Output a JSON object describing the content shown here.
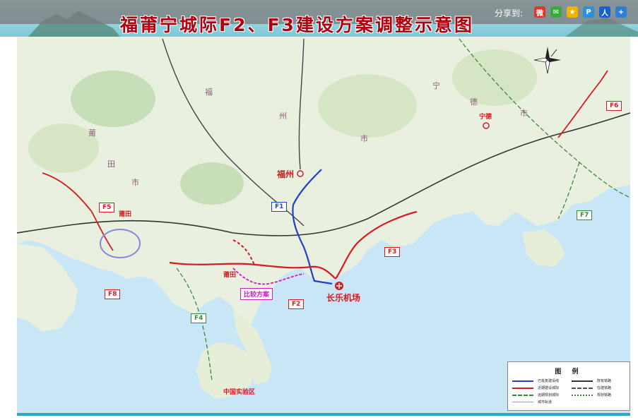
{
  "title": "福莆宁城际F2、F3建设方案调整示意图",
  "share": {
    "label": "分享到:",
    "buttons": [
      {
        "name": "weibo-share-icon",
        "glyph": "微",
        "color": "#e0382c"
      },
      {
        "name": "wechat-share-icon",
        "glyph": "✉",
        "color": "#3aa83a"
      },
      {
        "name": "qzone-share-icon",
        "glyph": "★",
        "color": "#f0b400"
      },
      {
        "name": "tencent-share-icon",
        "glyph": "P",
        "color": "#2b8fd9"
      },
      {
        "name": "renren-share-icon",
        "glyph": "人",
        "color": "#1a60c8"
      },
      {
        "name": "more-share-icon",
        "glyph": "+",
        "color": "#2d7fd5"
      }
    ]
  },
  "map": {
    "colors": {
      "f1": "#1f3fc7",
      "f2": "#d71920",
      "f3": "#d71920",
      "alt": "#cc1fb8",
      "sea": "#c8e6f6",
      "land": "#e9f0df"
    },
    "route_labels": {
      "f1": "F1",
      "f2": "F2",
      "f3": "F3",
      "f4": "F4",
      "f5": "F5",
      "f6": "F6",
      "f7": "F7",
      "f8": "F8",
      "alt": "比较方案"
    },
    "places": {
      "fuzhou": "福州",
      "putian": "莆田",
      "putian_2": "莆田",
      "ningde": "宁德",
      "changle_airport": "长乐机场",
      "zhongguo_shiyan": "中国实验区"
    },
    "regions": {
      "fu": "福",
      "zhou": "州",
      "shi": "市",
      "ning": "宁",
      "de": "德",
      "shi_2": "市",
      "pu": "莆",
      "tian": "田",
      "shi_3": "市"
    }
  },
  "legend": {
    "title": "图 例",
    "items": [
      {
        "label": "已批复建设线",
        "color": "#1f3fc7",
        "style": "solid"
      },
      {
        "label": "近期建设城际",
        "color": "#d71920",
        "style": "solid"
      },
      {
        "label": "远期规划城际",
        "color": "#3a8a3a",
        "style": "dashed"
      },
      {
        "label": "城市轨道",
        "color": "#5fc1c8",
        "style": "solid"
      },
      {
        "label": "既有铁路",
        "color": "#333333",
        "style": "solid"
      },
      {
        "label": "在建铁路",
        "color": "#555555",
        "style": "dashed"
      },
      {
        "label": "规划铁路",
        "color": "#3a8a3a",
        "style": "dashdot"
      }
    ]
  }
}
